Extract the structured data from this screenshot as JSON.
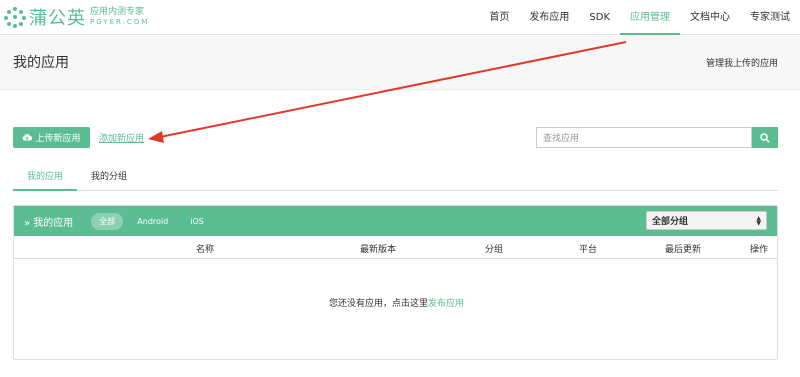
{
  "logo": {
    "name": "蒲公英",
    "sub_cn": "应用内测专家",
    "sub_en": "PGYER.COM"
  },
  "nav": {
    "items": [
      {
        "label": "首页",
        "active": false
      },
      {
        "label": "发布应用",
        "active": false
      },
      {
        "label": "SDK",
        "active": false
      },
      {
        "label": "应用管理",
        "active": true
      },
      {
        "label": "文档中心",
        "active": false
      },
      {
        "label": "专家测试",
        "active": false
      }
    ]
  },
  "subheader": {
    "title": "我的应用",
    "manage_link": "管理我上传的应用"
  },
  "actions": {
    "upload_label": "上传新应用",
    "add_label": "添加新应用"
  },
  "search": {
    "placeholder": "查找应用"
  },
  "tabs": [
    {
      "label": "我的应用",
      "active": true
    },
    {
      "label": "我的分组",
      "active": false
    }
  ],
  "panel": {
    "title": "» 我的应用",
    "filters": [
      {
        "label": "全部",
        "active": true
      },
      {
        "label": "Android",
        "active": false
      },
      {
        "label": "iOS",
        "active": false
      }
    ],
    "group_select": "全部分组",
    "columns": [
      "名称",
      "最新版本",
      "分组",
      "平台",
      "最后更新",
      "操作"
    ],
    "empty_text": "您还没有应用，点击这里",
    "empty_link": "发布应用"
  },
  "colors": {
    "accent": "#5bbd91",
    "annotation": "#e0392b"
  }
}
